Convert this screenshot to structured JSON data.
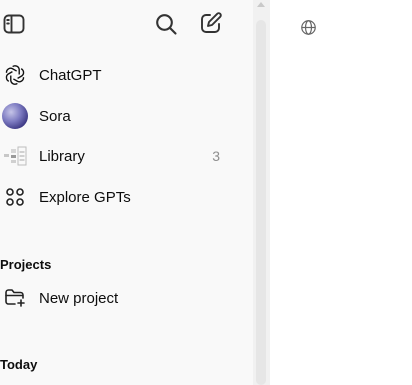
{
  "sidebar": {
    "nav": [
      {
        "label": "ChatGPT",
        "icon": "chatgpt-logo-icon"
      },
      {
        "label": "Sora",
        "icon": "sora-avatar"
      },
      {
        "label": "Library",
        "icon": "library-thumbnail",
        "count": "3"
      },
      {
        "label": "Explore GPTs",
        "icon": "grid-icon"
      }
    ],
    "projects": {
      "title": "Projects",
      "new_label": "New project"
    },
    "today": {
      "title": "Today"
    }
  },
  "toolbar_icons": [
    "sidebar-toggle-icon",
    "search-icon",
    "new-chat-icon",
    "globe-icon"
  ]
}
